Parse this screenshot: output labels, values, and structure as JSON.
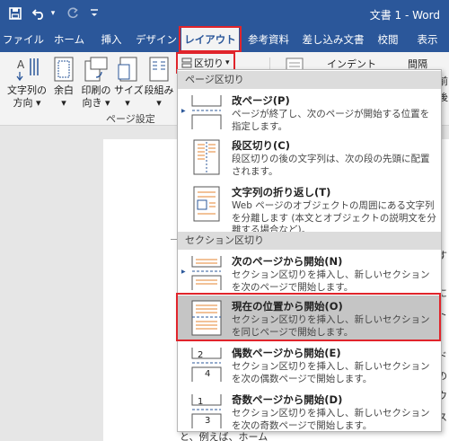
{
  "titlebar": {
    "title": "文書 1 - Word",
    "undo_dropdown": "▾",
    "colors": {
      "bar": "#2b579a",
      "highlight": "#e0242b"
    }
  },
  "tabs": [
    {
      "label": "ファイル"
    },
    {
      "label": "ホーム"
    },
    {
      "label": "挿入"
    },
    {
      "label": "デザイン"
    },
    {
      "label": "レイアウト"
    },
    {
      "label": "参考資料"
    },
    {
      "label": "差し込み文書"
    },
    {
      "label": "校閲"
    },
    {
      "label": "表示"
    }
  ],
  "ribbon": {
    "text_direction": {
      "line1": "文字列の",
      "line2": "方向 ▾"
    },
    "margins": {
      "line1": "余白",
      "line2": "▾"
    },
    "orientation": {
      "line1": "印刷の",
      "line2": "向き ▾"
    },
    "size": {
      "line1": "サイズ",
      "line2": "▾"
    },
    "columns": {
      "line1": "段組み",
      "line2": "▾"
    },
    "page_setup_label": "ページ設定",
    "breaks_button": "区切り",
    "breaks_caret": "▾",
    "indent_label": "インデント",
    "spacing_label": "間隔",
    "before_label": "前",
    "after_label": "後"
  },
  "document": {
    "right_fragments": [
      "す",
      "。",
      "に",
      "ト",
      "ド",
      "の",
      "ウ",
      "ス"
    ],
    "bottom_line": "と、例えば、ホーム"
  },
  "dropdown": {
    "sections": [
      {
        "header": "ページ区切り",
        "items": [
          {
            "title": "改ページ(P)",
            "desc": "ページが終了し、次のページが開始する位置を指定します。"
          },
          {
            "title": "段区切り(C)",
            "desc": "段区切りの後の文字列は、次の段の先頭に配置されます。"
          },
          {
            "title": "文字列の折り返し(T)",
            "desc": "Web ページのオブジェクトの周囲にある文字列を分離します (本文とオブジェクトの説明文を分離する場合など)。"
          }
        ]
      },
      {
        "header": "セクション区切り",
        "items": [
          {
            "title": "次のページから開始(N)",
            "desc": "セクション区切りを挿入し、新しいセクションを次のページで開始します。"
          },
          {
            "title": "現在の位置から開始(O)",
            "desc": "セクション区切りを挿入し、新しいセクションを同じページで開始します。"
          },
          {
            "title": "偶数ページから開始(E)",
            "desc": "セクション区切りを挿入し、新しいセクションを次の偶数ページで開始します。"
          },
          {
            "title": "奇数ページから開始(D)",
            "desc": "セクション区切りを挿入し、新しいセクションを次の奇数ページで開始します。"
          }
        ]
      }
    ],
    "icon_numbers": {
      "even_a": "2",
      "even_b": "4",
      "odd_a": "1",
      "odd_b": "3"
    }
  }
}
